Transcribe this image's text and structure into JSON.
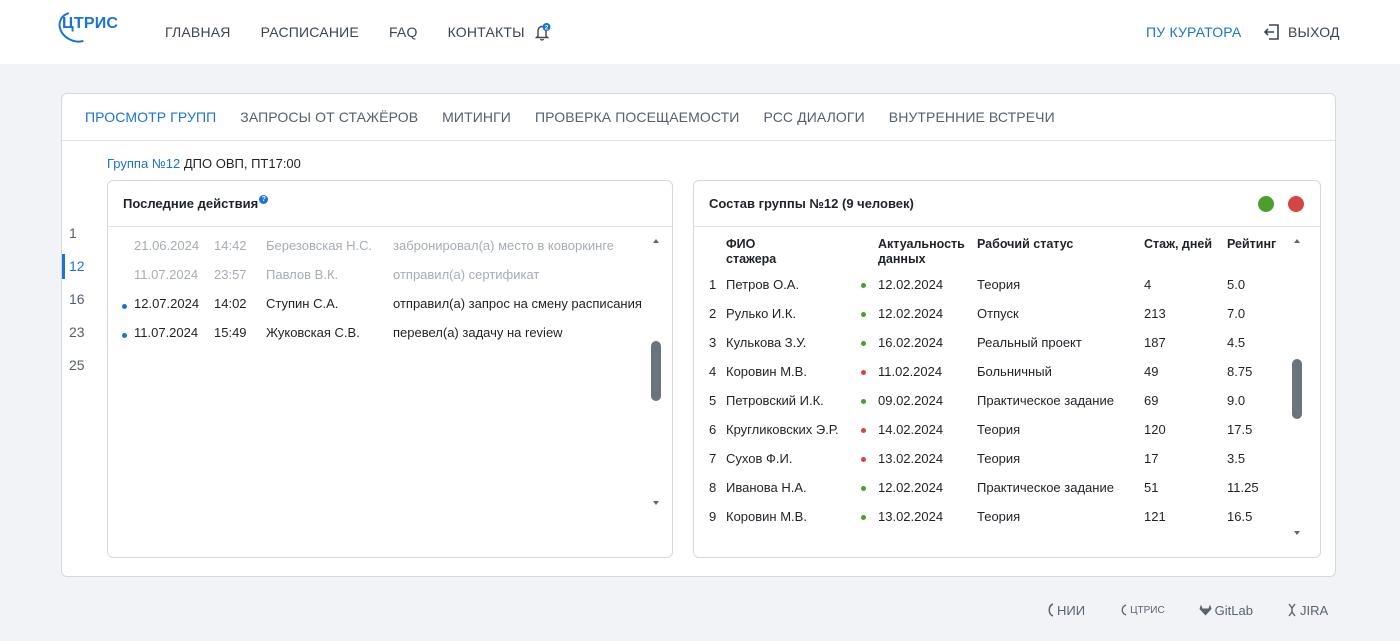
{
  "header": {
    "logo": "ЦТРИС",
    "nav": [
      "ГЛАВНАЯ",
      "РАСПИСАНИЕ",
      "FAQ",
      "КОНТАКТЫ"
    ],
    "notifications_count": "2",
    "curator_link": "ПУ КУРАТОРА",
    "logout": "ВЫХОД"
  },
  "tabs": [
    "ПРОСМОТР ГРУПП",
    "ЗАПРОСЫ ОТ СТАЖЁРОВ",
    "МИТИНГИ",
    "ПРОВЕРКА ПОСЕЩАЕМОСТИ",
    "РСС ДИАЛОГИ",
    "ВНУТРЕННИЕ ВСТРЕЧИ"
  ],
  "group": {
    "link": "Группа №12",
    "rest": " ДПО ОВП, ПТ17:00"
  },
  "group_numbers": [
    "1",
    "12",
    "16",
    "23",
    "25"
  ],
  "recent": {
    "title": "Последние действия",
    "help": "?",
    "rows": [
      {
        "date": "21.06.2024",
        "time": "14:42",
        "who": "Березовская Н.С.",
        "what": "забронировал(а) место в коворкинге",
        "new": false
      },
      {
        "date": "11.07.2024",
        "time": "23:57",
        "who": "Павлов В.К.",
        "what": "отправил(а) сертификат",
        "new": false
      },
      {
        "date": "12.07.2024",
        "time": "14:02",
        "who": "Ступин С.А.",
        "what": "отправил(а) запрос на смену расписания",
        "new": true
      },
      {
        "date": "11.07.2024",
        "time": "15:49",
        "who": "Жуковская С.В.",
        "what": "перевел(а) задачу на review",
        "new": true
      }
    ]
  },
  "roster": {
    "title": "Состав группы №12 (9 человек)",
    "columns": {
      "name": "ФИО\nстажера",
      "date": "Актуальность\nданных",
      "status": "Рабочий статус",
      "stage": "Стаж, дней",
      "rate": "Рейтинг"
    },
    "rows": [
      {
        "n": "1",
        "name": "Петров О.А.",
        "ok": true,
        "date": "12.02.2024",
        "status": "Теория",
        "stage": "4",
        "rate": "5.0"
      },
      {
        "n": "2",
        "name": "Рулько И.К.",
        "ok": true,
        "date": "12.02.2024",
        "status": "Отпуск",
        "stage": "213",
        "rate": "7.0"
      },
      {
        "n": "3",
        "name": "Кулькова З.У.",
        "ok": true,
        "date": "16.02.2024",
        "status": "Реальный проект",
        "stage": "187",
        "rate": "4.5"
      },
      {
        "n": "4",
        "name": "Коровин М.В.",
        "ok": false,
        "date": "11.02.2024",
        "status": "Больничный",
        "stage": "49",
        "rate": "8.75"
      },
      {
        "n": "5",
        "name": "Петровский И.К.",
        "ok": true,
        "date": "09.02.2024",
        "status": "Практическое задание",
        "stage": "69",
        "rate": "9.0"
      },
      {
        "n": "6",
        "name": "Кругликовских Э.Р.",
        "ok": false,
        "date": "14.02.2024",
        "status": "Теория",
        "stage": "120",
        "rate": "17.5"
      },
      {
        "n": "7",
        "name": "Сухов Ф.И.",
        "ok": false,
        "date": "13.02.2024",
        "status": "Теория",
        "stage": "17",
        "rate": "3.5"
      },
      {
        "n": "8",
        "name": "Иванова Н.А.",
        "ok": true,
        "date": "12.02.2024",
        "status": "Практическое задание",
        "stage": "51",
        "rate": "11.25"
      },
      {
        "n": "9",
        "name": "Коровин М.В.",
        "ok": true,
        "date": "13.02.2024",
        "status": "Теория",
        "stage": "121",
        "rate": "16.5"
      }
    ]
  },
  "footer": [
    "НИИ",
    "ЦТРИС",
    "GitLab",
    "JIRA"
  ],
  "colors": {
    "accent": "#1a73d9",
    "ok": "#4c9f2c",
    "bad": "#d64545"
  }
}
